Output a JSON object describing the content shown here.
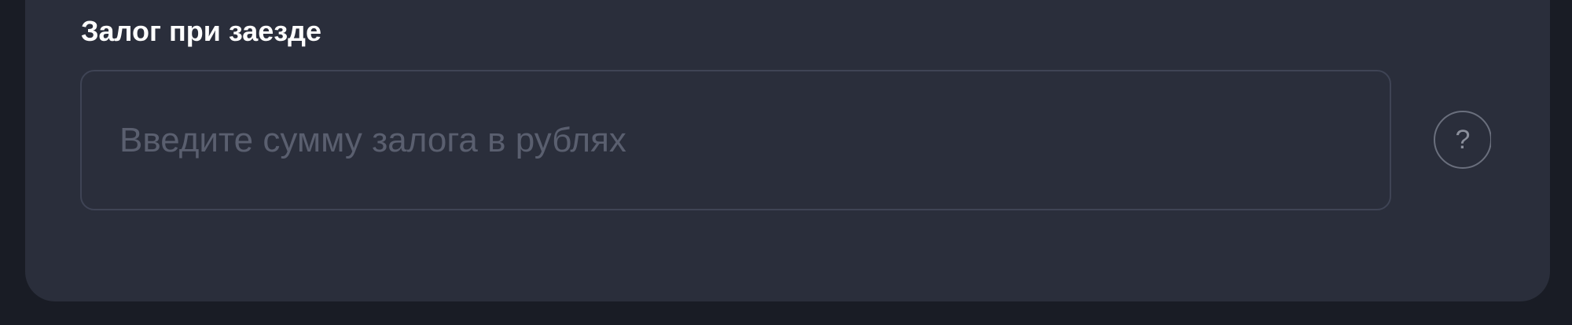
{
  "deposit": {
    "label": "Залог при заезде",
    "input_value": "",
    "input_placeholder": "Введите сумму залога в рублях",
    "help_icon_text": "?"
  },
  "colors": {
    "page_background": "#191c25",
    "card_background": "#2a2e3b",
    "input_border": "#3f4455",
    "label_text": "#ffffff",
    "placeholder_text": "#5a5f6f",
    "help_icon": "#8b8f9b"
  }
}
